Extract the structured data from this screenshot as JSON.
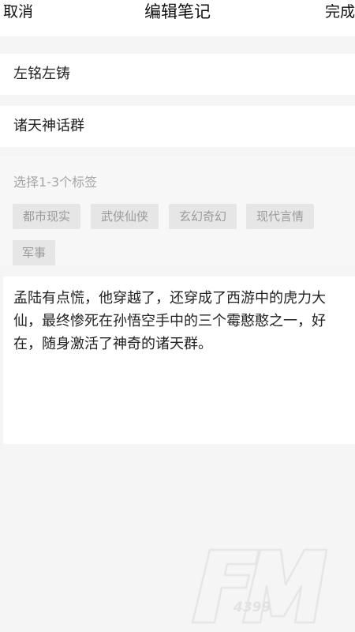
{
  "header": {
    "cancel_label": "取消",
    "title": "编辑笔记",
    "done_label": "完成"
  },
  "fields": {
    "author_value": "左铭左铸",
    "group_value": "诸天神话群"
  },
  "tags": {
    "hint": "选择1-3个标签",
    "items": [
      "都市现实",
      "武侠仙侠",
      "玄幻奇幻",
      "现代言情",
      "军事"
    ]
  },
  "note": {
    "content": "孟陆有点慌，他穿越了，还穿成了西游中的虎力大仙，最终惨死在孙悟空手中的三个霉憨憨之一，好在，随身激活了神奇的诸天群。"
  },
  "watermark": {
    "logo_text": "FM",
    "sub_text": "4399"
  },
  "colors": {
    "background": "#f5f5f5",
    "tag_bg": "#e6e6e6",
    "tag_text": "#9a9a9a",
    "hint_text": "#a6a6a6"
  }
}
